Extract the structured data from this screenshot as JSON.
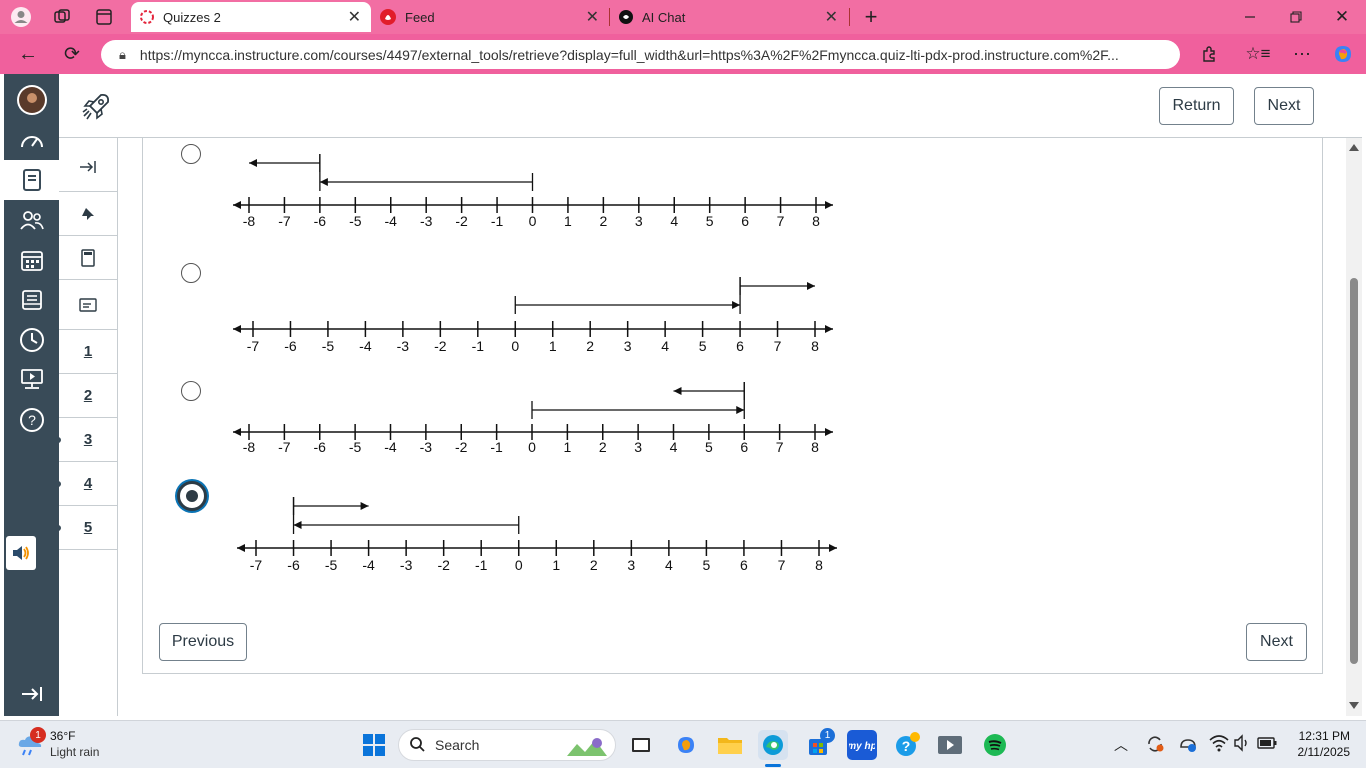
{
  "browser": {
    "tabs": [
      {
        "label": "Quizzes 2",
        "active": true
      },
      {
        "label": "Feed",
        "active": false
      },
      {
        "label": "AI Chat",
        "active": false
      }
    ],
    "url": "https://myncca.instructure.com/courses/4497/external_tools/retrieve?display=full_width&url=https%3A%2F%2Fmyncca.quiz-lti-pdx-prod.instructure.com%2F..."
  },
  "header": {
    "return_label": "Return",
    "next_label": "Next"
  },
  "side_tools": {
    "questions": [
      "1",
      "2",
      "3",
      "4",
      "5"
    ]
  },
  "question": {
    "options": [
      {
        "ticks": [
          "-8",
          "-7",
          "-6",
          "-5",
          "-4",
          "-3",
          "-2",
          "-1",
          "0",
          "1",
          "2",
          "3",
          "4",
          "5",
          "6",
          "7",
          "8"
        ],
        "arrows": [
          {
            "from": -6,
            "to": -8
          },
          {
            "from": 0,
            "to": -6
          }
        ],
        "selected": false
      },
      {
        "ticks": [
          "-7",
          "-6",
          "-5",
          "-4",
          "-3",
          "-2",
          "-1",
          "0",
          "1",
          "2",
          "3",
          "4",
          "5",
          "6",
          "7",
          "8"
        ],
        "arrows": [
          {
            "from": 6,
            "to": 8
          },
          {
            "from": 0,
            "to": 6
          }
        ],
        "selected": false
      },
      {
        "ticks": [
          "-8",
          "-7",
          "-6",
          "-5",
          "-4",
          "-3",
          "-2",
          "-1",
          "0",
          "1",
          "2",
          "3",
          "4",
          "5",
          "6",
          "7",
          "8"
        ],
        "arrows": [
          {
            "from": 6,
            "to": 4
          },
          {
            "from": 0,
            "to": 6
          }
        ],
        "selected": false
      },
      {
        "ticks": [
          "-7",
          "-6",
          "-5",
          "-4",
          "-3",
          "-2",
          "-1",
          "0",
          "1",
          "2",
          "3",
          "4",
          "5",
          "6",
          "7",
          "8"
        ],
        "arrows": [
          {
            "from": -6,
            "to": -4
          },
          {
            "from": 0,
            "to": -6
          }
        ],
        "selected": true
      }
    ]
  },
  "footer": {
    "previous_label": "Previous",
    "next_label": "Next"
  },
  "taskbar": {
    "weather_temp": "36°F",
    "weather_desc": "Light rain",
    "weather_badge": "1",
    "search_placeholder": "Search",
    "store_badge": "1",
    "time": "12:31 PM",
    "date": "2/11/2025"
  }
}
